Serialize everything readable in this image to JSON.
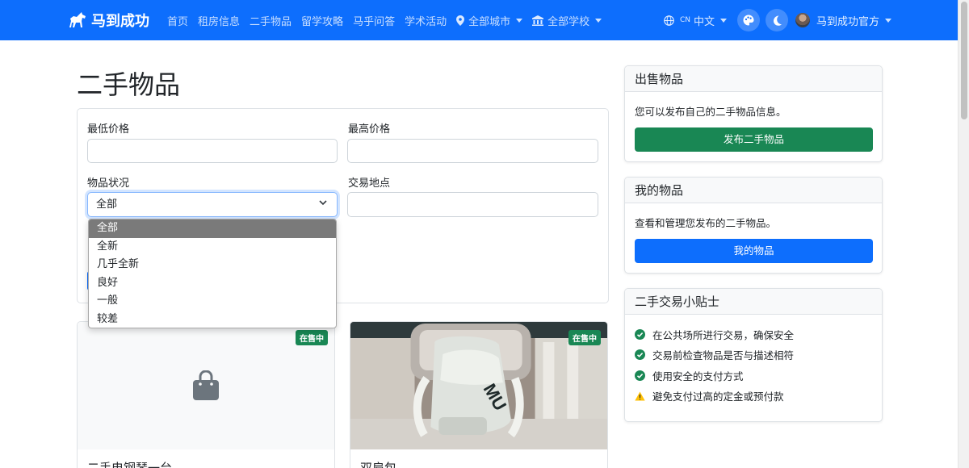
{
  "navbar": {
    "brand": "马到成功",
    "links": [
      "首页",
      "租房信息",
      "二手物品",
      "留学攻略",
      "马乎问答",
      "学术活动"
    ],
    "city_dropdown": "全部城市",
    "school_dropdown": "全部学校",
    "lang_code": "CN",
    "lang_label": "中文",
    "user_name": "马到成功官方"
  },
  "page": {
    "title": "二手物品"
  },
  "filters": {
    "min_price_label": "最低价格",
    "min_price_value": "",
    "max_price_label": "最高价格",
    "max_price_value": "",
    "condition_label": "物品状况",
    "condition_value": "全部",
    "condition_options": [
      "全部",
      "全新",
      "几乎全新",
      "良好",
      "一般",
      "较差"
    ],
    "location_label": "交易地点",
    "location_value": ""
  },
  "products": [
    {
      "title": "二手电钢琴一台",
      "status": "在售中",
      "image": "bag-placeholder-icon"
    },
    {
      "title": "双肩包",
      "status": "在售中",
      "image": "backpack-photo"
    }
  ],
  "sidebar": {
    "sell": {
      "title": "出售物品",
      "text": "您可以发布自己的二手物品信息。",
      "button": "发布二手物品",
      "button_color": "#198754"
    },
    "mine": {
      "title": "我的物品",
      "text": "查看和管理您发布的二手物品。",
      "button": "我的物品",
      "button_color": "#0d6efd"
    },
    "tips": {
      "title": "二手交易小贴士",
      "items": [
        {
          "text": "在公共场所进行交易，确保安全",
          "icon": "check-circle-icon"
        },
        {
          "text": "交易前检查物品是否与描述相符",
          "icon": "check-circle-icon"
        },
        {
          "text": "使用安全的支付方式",
          "icon": "check-circle-icon"
        },
        {
          "text": "避免支付过高的定金或预付款",
          "icon": "warning-icon"
        }
      ]
    }
  },
  "colors": {
    "primary": "#0d6efd",
    "success": "#198754",
    "warning": "#ffc107"
  }
}
